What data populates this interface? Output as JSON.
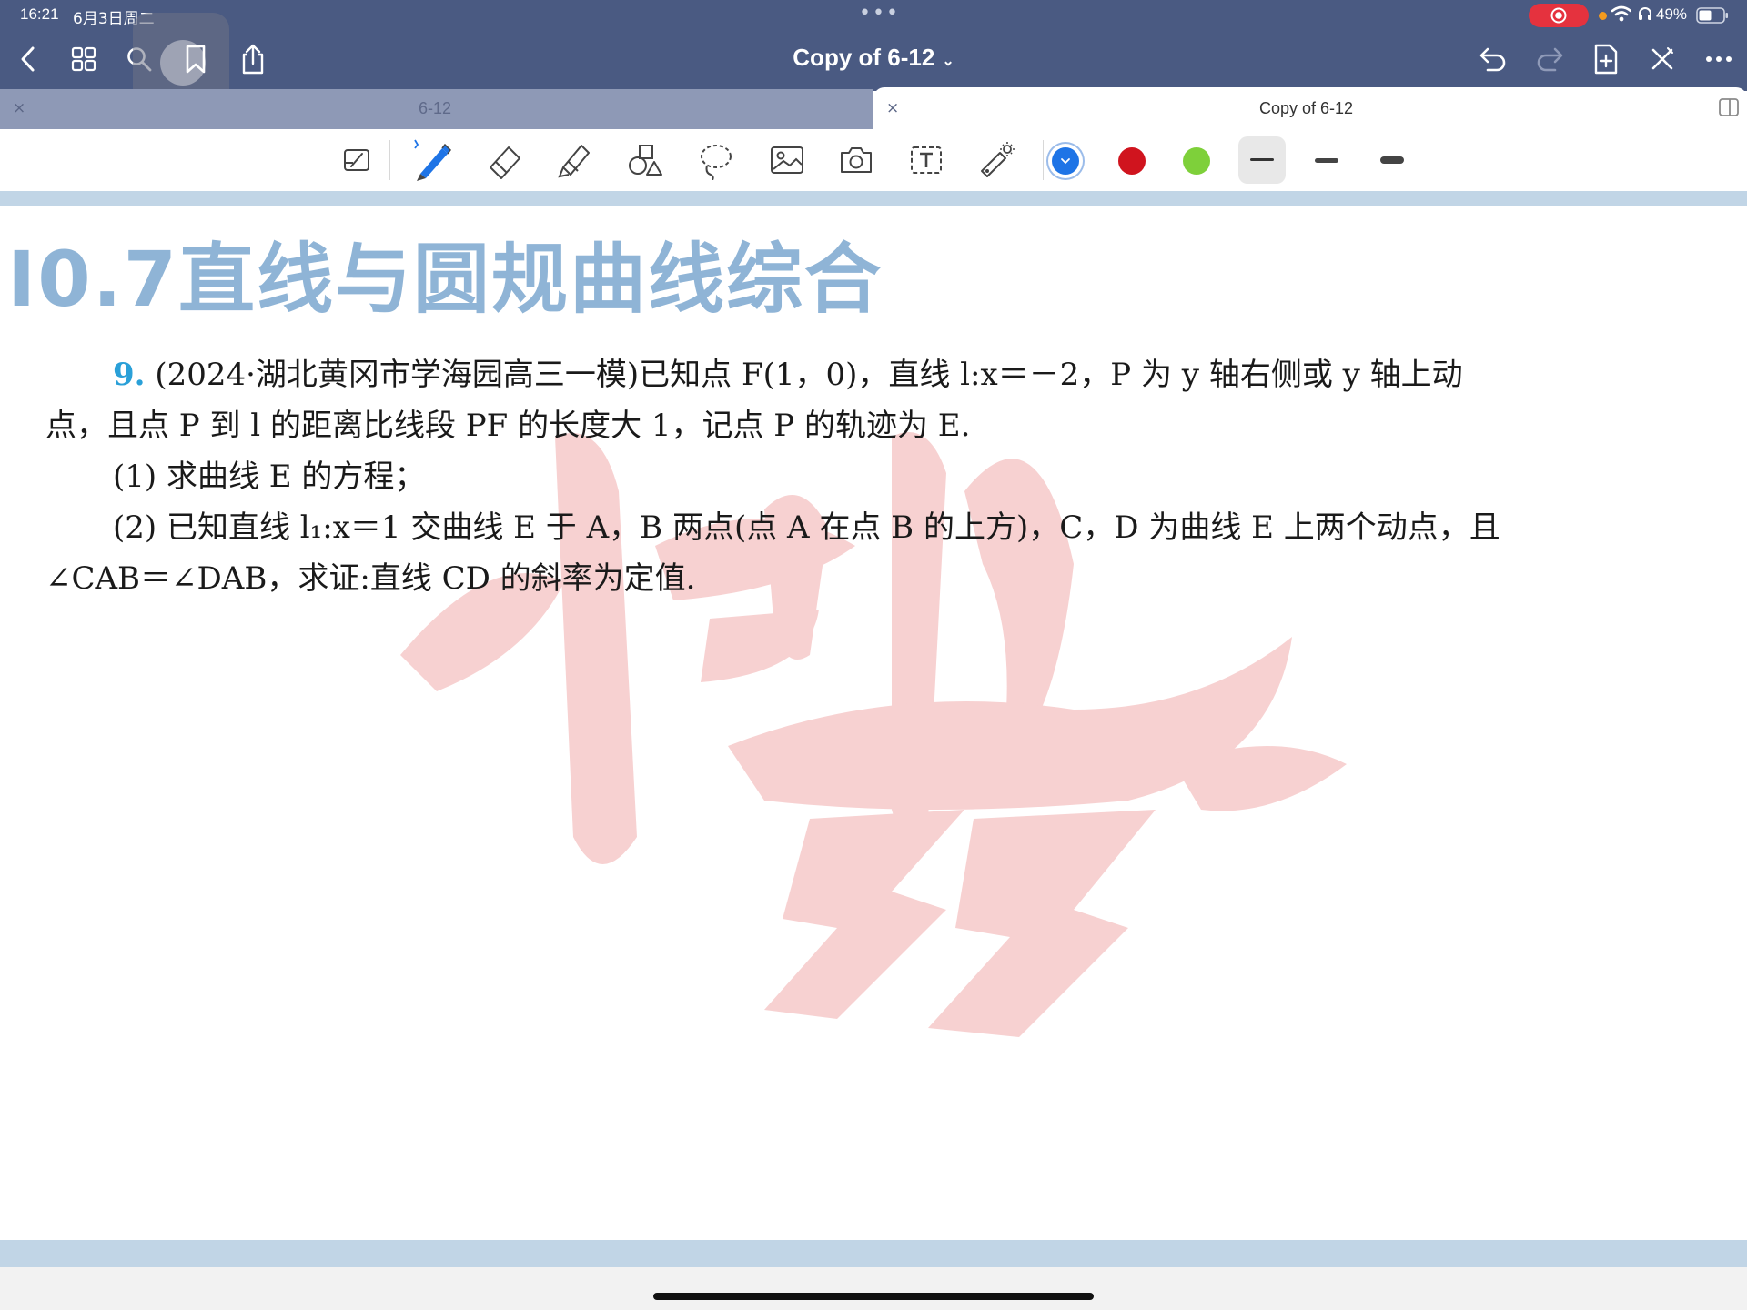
{
  "status": {
    "time": "16:21",
    "date": "6月3日周二",
    "battery": "49%"
  },
  "header": {
    "title": "Copy of 6-12",
    "title_chevron": "⌄"
  },
  "tabs": [
    {
      "label": "6-12",
      "close": "×"
    },
    {
      "label": "Copy of 6-12",
      "close": "×"
    }
  ],
  "icons": {
    "back": "chevron-left-icon",
    "grid": "grid-icon",
    "search": "search-icon",
    "bookmark": "bookmark-icon",
    "share": "share-icon",
    "undo": "undo-icon",
    "redo": "redo-icon",
    "add_page": "add-page-icon",
    "close": "close-icon",
    "more": "more-icon"
  },
  "tools": {
    "selected_color": "#1e74e6",
    "colors": [
      "#1e74e6",
      "#d0141e",
      "#7ed03a"
    ],
    "selected_width": "thin"
  },
  "page": {
    "section_title": "I0.7直线与圆规曲线综合",
    "question": {
      "number": "9.",
      "line1": "(2024·湖北黄冈市学海园高三一模)已知点 F(1，0)，直线 l:x＝－2，P 为 y 轴右侧或 y 轴上动",
      "line2": "点，且点 P 到 l 的距离比线段 PF 的长度大 1，记点 P 的轨迹为 E.",
      "part1": "(1) 求曲线 E 的方程；",
      "part2": "(2) 已知直线 l₁:x＝1 交曲线 E 于 A，B 两点(点 A 在点 B 的上方)，C，D 为曲线 E 上两个动点，且",
      "part2_line2": "∠CAB＝∠DAB，求证:直线 CD 的斜率为定值."
    }
  }
}
